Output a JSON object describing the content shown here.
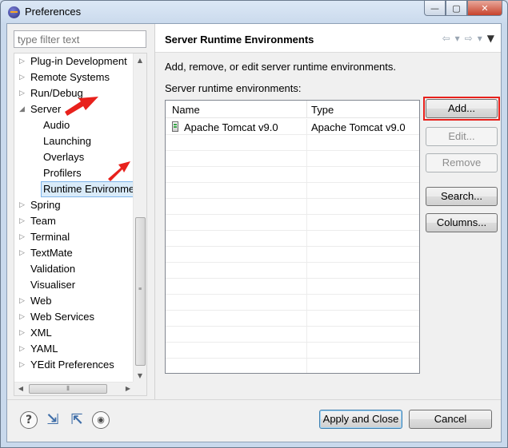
{
  "window": {
    "title": "Preferences",
    "controls": {
      "minimize": "—",
      "maximize": "▢",
      "close": "✕"
    }
  },
  "filter": {
    "placeholder": "type filter text"
  },
  "tree": {
    "items": [
      {
        "label": "Plug-in Development",
        "expandable": true,
        "level": 0
      },
      {
        "label": "Remote Systems",
        "expandable": true,
        "level": 0
      },
      {
        "label": "Run/Debug",
        "expandable": true,
        "level": 0
      },
      {
        "label": "Server",
        "expandable": true,
        "expanded": true,
        "level": 0
      },
      {
        "label": "Audio",
        "level": 1
      },
      {
        "label": "Launching",
        "level": 1
      },
      {
        "label": "Overlays",
        "level": 1
      },
      {
        "label": "Profilers",
        "level": 1
      },
      {
        "label": "Runtime Environme",
        "level": 1,
        "selected": true
      },
      {
        "label": "Spring",
        "expandable": true,
        "level": 0
      },
      {
        "label": "Team",
        "expandable": true,
        "level": 0
      },
      {
        "label": "Terminal",
        "expandable": true,
        "level": 0
      },
      {
        "label": "TextMate",
        "expandable": true,
        "level": 0
      },
      {
        "label": "Validation",
        "level": 0
      },
      {
        "label": "Visualiser",
        "level": 0
      },
      {
        "label": "Web",
        "expandable": true,
        "level": 0
      },
      {
        "label": "Web Services",
        "expandable": true,
        "level": 0
      },
      {
        "label": "XML",
        "expandable": true,
        "level": 0
      },
      {
        "label": "YAML",
        "expandable": true,
        "level": 0
      },
      {
        "label": "YEdit Preferences",
        "expandable": true,
        "level": 0
      }
    ]
  },
  "page": {
    "title": "Server Runtime Environments",
    "description": "Add, remove, or edit server runtime environments.",
    "list_label": "Server runtime environments:"
  },
  "table": {
    "columns": [
      "Name",
      "Type"
    ],
    "rows": [
      {
        "name": "Apache Tomcat v9.0",
        "type": "Apache Tomcat v9.0"
      }
    ]
  },
  "buttons": {
    "add": "Add...",
    "edit": "Edit...",
    "remove": "Remove",
    "search": "Search...",
    "columns": "Columns...",
    "apply_close": "Apply and Close",
    "cancel": "Cancel"
  },
  "icons": {
    "help": "?",
    "import": "⇲",
    "export": "⇱",
    "record": "◉"
  },
  "colors": {
    "highlight_red": "#e8211c",
    "selection": "#d9ebf9"
  }
}
